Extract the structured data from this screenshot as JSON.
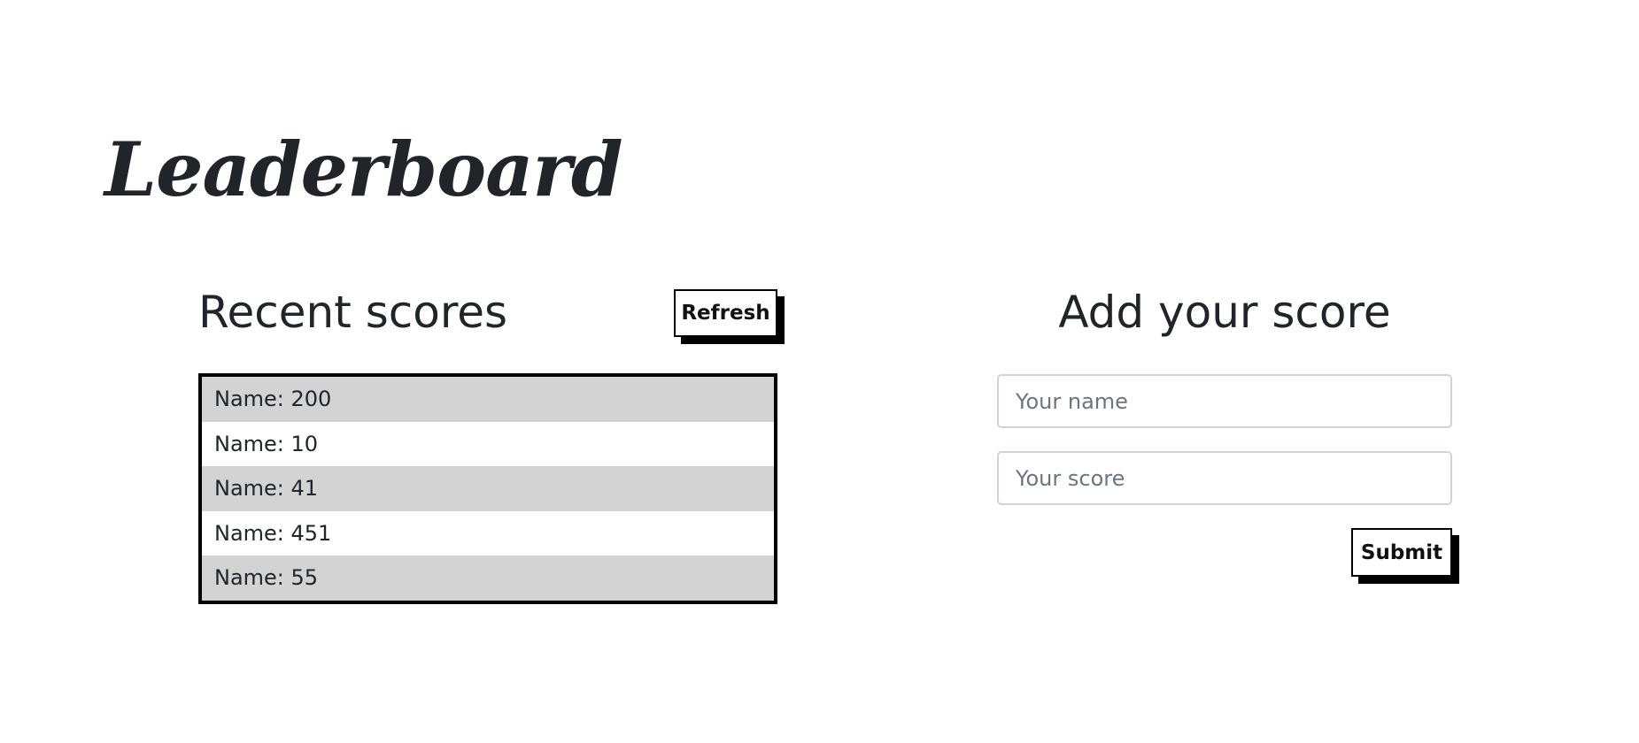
{
  "app": {
    "title": "Leaderboard"
  },
  "recent": {
    "heading": "Recent scores",
    "refresh_label": "Refresh",
    "scores": [
      "Name: 200",
      "Name: 10",
      "Name: 41",
      "Name: 451",
      "Name: 55"
    ]
  },
  "add_form": {
    "heading": "Add your score",
    "name_placeholder": "Your name",
    "name_value": "",
    "score_placeholder": "Your score",
    "score_value": "",
    "submit_label": "Submit"
  },
  "colors": {
    "row_odd": "#d3d3d3",
    "row_even": "#ffffff",
    "border": "#000000",
    "text": "#212529",
    "placeholder": "#6c757d",
    "input_border": "#ced4da"
  }
}
